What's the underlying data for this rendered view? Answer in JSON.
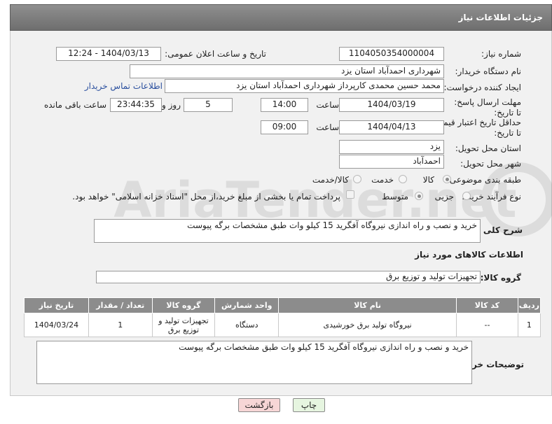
{
  "header": {
    "title": "جزئیات اطلاعات نیاز"
  },
  "fields": {
    "need_number_label": "شماره نیاز:",
    "need_number": "1104050354000004",
    "announce_label": "تاریخ و ساعت اعلان عمومی:",
    "announce_value": "1404/03/13 - 12:24",
    "buyer_org_label": "نام دستگاه خریدار:",
    "buyer_org": "شهرداری احمدآباد استان یزد",
    "creator_label": "ایجاد کننده درخواست:",
    "creator": "محمد حسین محمدی کارپرداز شهرداری احمدآباد استان یزد",
    "contact_link": "اطلاعات تماس خریدار",
    "deadline_label": "مهلت ارسال پاسخ: تا تاریخ:",
    "deadline_date": "1404/03/19",
    "time_label": "ساعت",
    "deadline_time": "14:00",
    "days_value": "5",
    "days_label": "روز و",
    "remaining_time": "23:44:35",
    "remaining_label": "ساعت باقی مانده",
    "min_price_label": "حداقل تاریخ اعتبار قیمت: تا تاریخ:",
    "min_price_date": "1404/04/13",
    "min_price_time": "09:00",
    "province_label": "استان محل تحویل:",
    "province": "یزد",
    "city_label": "شهر محل تحویل:",
    "city": "احمدآباد",
    "category_label": "طبقه بندی موضوعی:",
    "category_options": [
      "کالا",
      "خدمت",
      "کالا/خدمت"
    ],
    "process_label": "نوع فرآیند خرید :",
    "process_options": [
      "جزیی",
      "متوسط"
    ],
    "payment_note": "پرداخت تمام یا بخشی از مبلغ خرید،از محل \"اسناد خزانه اسلامی\" خواهد بود.",
    "summary_label": "شرح کلی نیاز:",
    "summary": "خرید و نصب و راه اندازی نیروگاه آفگرید 15 کیلو وات طبق مشخصات برگه پیوست"
  },
  "goods": {
    "section_title": "اطلاعات کالاهای مورد نیاز",
    "group_label": "گروه کالا:",
    "group_value": "تجهیزات تولید و توزیع برق",
    "columns": [
      "ردیف",
      "کد کالا",
      "نام کالا",
      "واحد شمارش",
      "گروه کالا",
      "تعداد / مقدار",
      "تاریخ نیاز"
    ],
    "rows": [
      {
        "index": "1",
        "code": "--",
        "name": "نیروگاه تولید برق خورشیدی",
        "unit": "دستگاه",
        "group": "تجهیزات تولید و توزیع برق",
        "qty": "1",
        "date": "1404/03/24"
      }
    ]
  },
  "buyer_notes": {
    "label": "توضیحات خریدار:",
    "text": "خرید و نصب و راه اندازی نیروگاه آفگرید 15 کیلو وات طبق مشخصات برگه پیوست"
  },
  "buttons": {
    "print": "چاپ",
    "back": "بازگشت"
  },
  "watermark_text": "AriaTender.net",
  "colors": {
    "titlebar": "#7a7a7a",
    "table_header": "#8c8c8c",
    "back_button": "#f7d6d6",
    "print_button": "#e6f5e0"
  }
}
